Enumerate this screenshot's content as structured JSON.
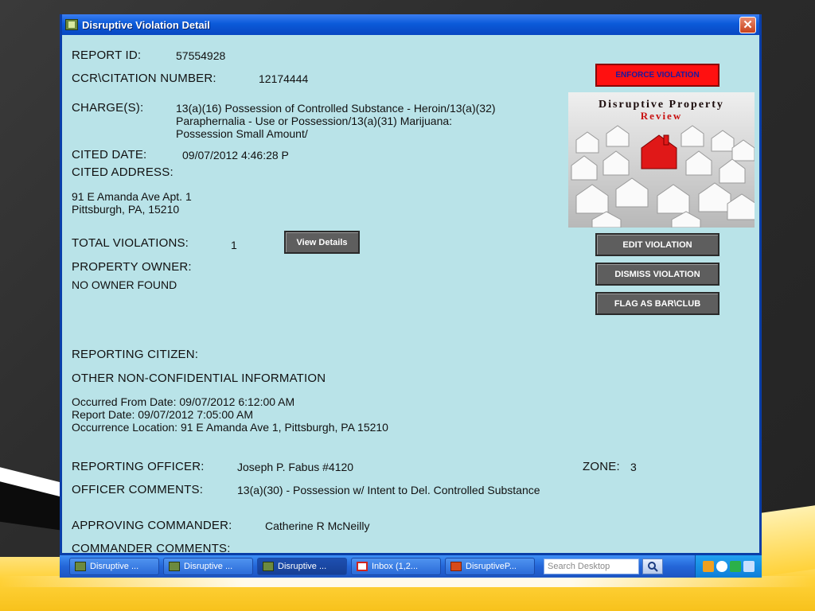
{
  "window": {
    "title": "Disruptive Violation Detail",
    "close_label": "✕"
  },
  "report": {
    "report_id_label": "REPORT  ID:",
    "report_id": "57554928",
    "ccr_label": "CCR\\CITATION NUMBER:",
    "ccr": "12174444",
    "charges_label": "CHARGE(S):",
    "charges_lines": [
      "13(a)(16) Possession of Controlled Substance - Heroin/13(a)(32)",
      "Paraphernalia - Use or Possession/13(a)(31) Marijuana:",
      "Possession Small Amount/"
    ],
    "cited_date_label": "CITED DATE:",
    "cited_date": "09/07/2012  4:46:28 P",
    "cited_address_label": "CITED ADDRESS:",
    "address_line1": "91 E Amanda Ave Apt. 1",
    "address_line2": "Pittsburgh, PA, 15210",
    "total_violations_label": "TOTAL VIOLATIONS:",
    "total_violations": "1",
    "property_owner_label": "PROPERTY OWNER:",
    "property_owner": "NO OWNER FOUND",
    "reporting_citizen_label": "REPORTING CITIZEN:",
    "other_info_label": "OTHER NON-CONFIDENTIAL INFORMATION",
    "occurred_from": "Occurred From Date: 09/07/2012 6:12:00 AM",
    "report_date": "Report Date: 09/07/2012 7:05:00 AM",
    "occurrence_location": "Occurrence Location: 91 E Amanda Ave 1, Pittsburgh, PA 15210",
    "reporting_officer_label": "REPORTING OFFICER:",
    "reporting_officer": "Joseph P. Fabus  #4120",
    "zone_label": "ZONE:",
    "zone": "3",
    "officer_comments_label": "OFFICER COMMENTS:",
    "officer_comments": "13(a)(30) - Possession w/ Intent to Del. Controlled Substance",
    "approving_commander_label": "APPROVING COMMANDER:",
    "approving_commander": "Catherine R McNeilly",
    "commander_comments_label": "COMMANDER COMMENTS:"
  },
  "buttons": {
    "view_details": "View Details",
    "enforce": "ENFORCE VIOLATION",
    "edit": "EDIT VIOLATION",
    "dismiss": "DISMISS VIOLATION",
    "flag": "FLAG AS BAR\\CLUB"
  },
  "image": {
    "title_line1": "Disruptive Property",
    "title_line2": "Review"
  },
  "taskbar": {
    "items": [
      {
        "label": "Disruptive ...",
        "icon": "app-icon"
      },
      {
        "label": "Disruptive ...",
        "icon": "app-icon"
      },
      {
        "label": "Disruptive ...",
        "icon": "app-icon"
      },
      {
        "label": "Inbox (1,2...",
        "icon": "gmail-icon"
      },
      {
        "label": "DisruptiveP...",
        "icon": "powerpoint-icon"
      }
    ],
    "search_placeholder": "Search Desktop"
  },
  "colors": {
    "content_bg": "#b9e3e8",
    "enforce_red": "#ff1010",
    "button_grey": "#5e5e5e",
    "titlebar_blue": "#0b5ad9"
  }
}
